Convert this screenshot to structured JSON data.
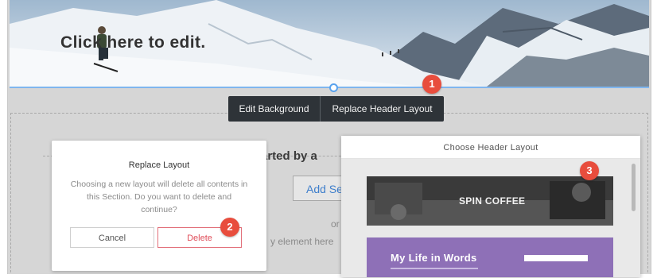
{
  "hero": {
    "title": "Click here to edit."
  },
  "toolbar": {
    "edit_background": "Edit Background",
    "replace_header_layout": "Replace Header Layout"
  },
  "badges": {
    "one": "1",
    "two": "2",
    "three": "3"
  },
  "background": {
    "started_text": "tarted by a",
    "add_button": "Add Se",
    "or_text": "or",
    "element_text": "y element here"
  },
  "dialog": {
    "title": "Replace Layout",
    "message": "Choosing a new layout will delete all contents in this Section. Do you want to delete and continue?",
    "cancel": "Cancel",
    "delete": "Delete"
  },
  "panel": {
    "title": "Choose Header Layout",
    "layouts": [
      {
        "label": "SPIN COFFEE"
      },
      {
        "label": "My Life in Words"
      }
    ]
  },
  "colors": {
    "accent_blue": "#5aa3ee",
    "badge_red": "#e84d3d",
    "delete_red": "#df4c58",
    "toolbar_dark": "#2e3338"
  }
}
